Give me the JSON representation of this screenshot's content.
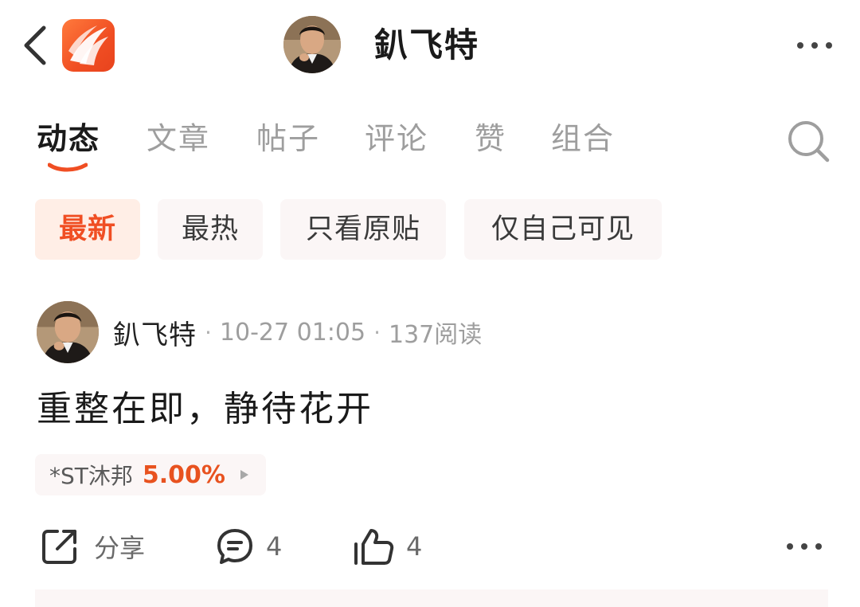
{
  "header": {
    "back_icon": "chevron-left-icon",
    "app_logo": "app-logo",
    "title": "釟飞特",
    "more_icon": "more-horizontal-icon"
  },
  "tabs": [
    {
      "label": "动态",
      "active": true
    },
    {
      "label": "文章",
      "active": false
    },
    {
      "label": "帖子",
      "active": false
    },
    {
      "label": "评论",
      "active": false
    },
    {
      "label": "赞",
      "active": false
    },
    {
      "label": "组合",
      "active": false
    }
  ],
  "search_icon": "search-icon",
  "filters": [
    {
      "label": "最新",
      "active": true
    },
    {
      "label": "最热",
      "active": false
    },
    {
      "label": "只看原贴",
      "active": false
    },
    {
      "label": "仅自己可见",
      "active": false
    }
  ],
  "post": {
    "author": "釟飞特",
    "separator": "·",
    "time": "10-27 01:05",
    "reads": "137阅读",
    "content": "重整在即，静待花开",
    "stock": {
      "name": "*ST沐邦",
      "change": "5.00%"
    },
    "actions": {
      "share_label": "分享",
      "comment_count": "4",
      "like_count": "4"
    }
  },
  "colors": {
    "accent": "#f04e23",
    "stock_up": "#e8521f",
    "chip_bg": "#fbf6f6",
    "active_chip_bg": "#ffeee6",
    "muted_text": "#9e9e9e"
  }
}
